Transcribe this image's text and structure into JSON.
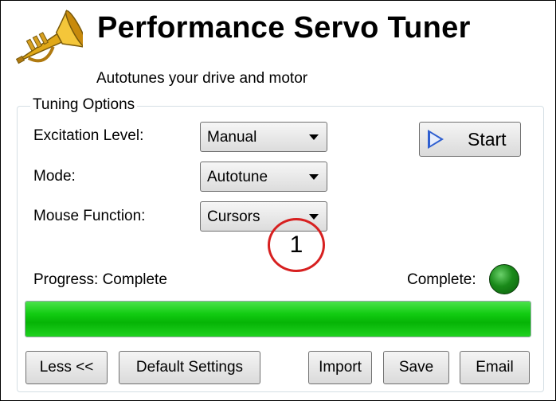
{
  "header": {
    "title": "Performance Servo Tuner",
    "subtitle": "Autotunes your drive and motor",
    "logo_icon": "trumpet-icon"
  },
  "tuning_options": {
    "group_title": "Tuning Options",
    "excitation_level": {
      "label": "Excitation Level:",
      "value": "Manual"
    },
    "mode": {
      "label": "Mode:",
      "value": "Autotune"
    },
    "mouse_function": {
      "label": "Mouse Function:",
      "value": "Cursors"
    },
    "start_button": {
      "label": "Start",
      "icon": "play-icon"
    },
    "callout_number": "1",
    "progress_label": "Progress: Complete",
    "status_label": "Complete:",
    "status_color": "#1a8a1a",
    "progress_fraction": 1.0
  },
  "buttons": {
    "less": "Less <<",
    "default_settings": "Default Settings",
    "import": "Import",
    "save": "Save",
    "email": "Email"
  },
  "colors": {
    "progress_green": "#12cc12",
    "callout_red": "#d72020",
    "start_blue": "#2f5fd0"
  }
}
